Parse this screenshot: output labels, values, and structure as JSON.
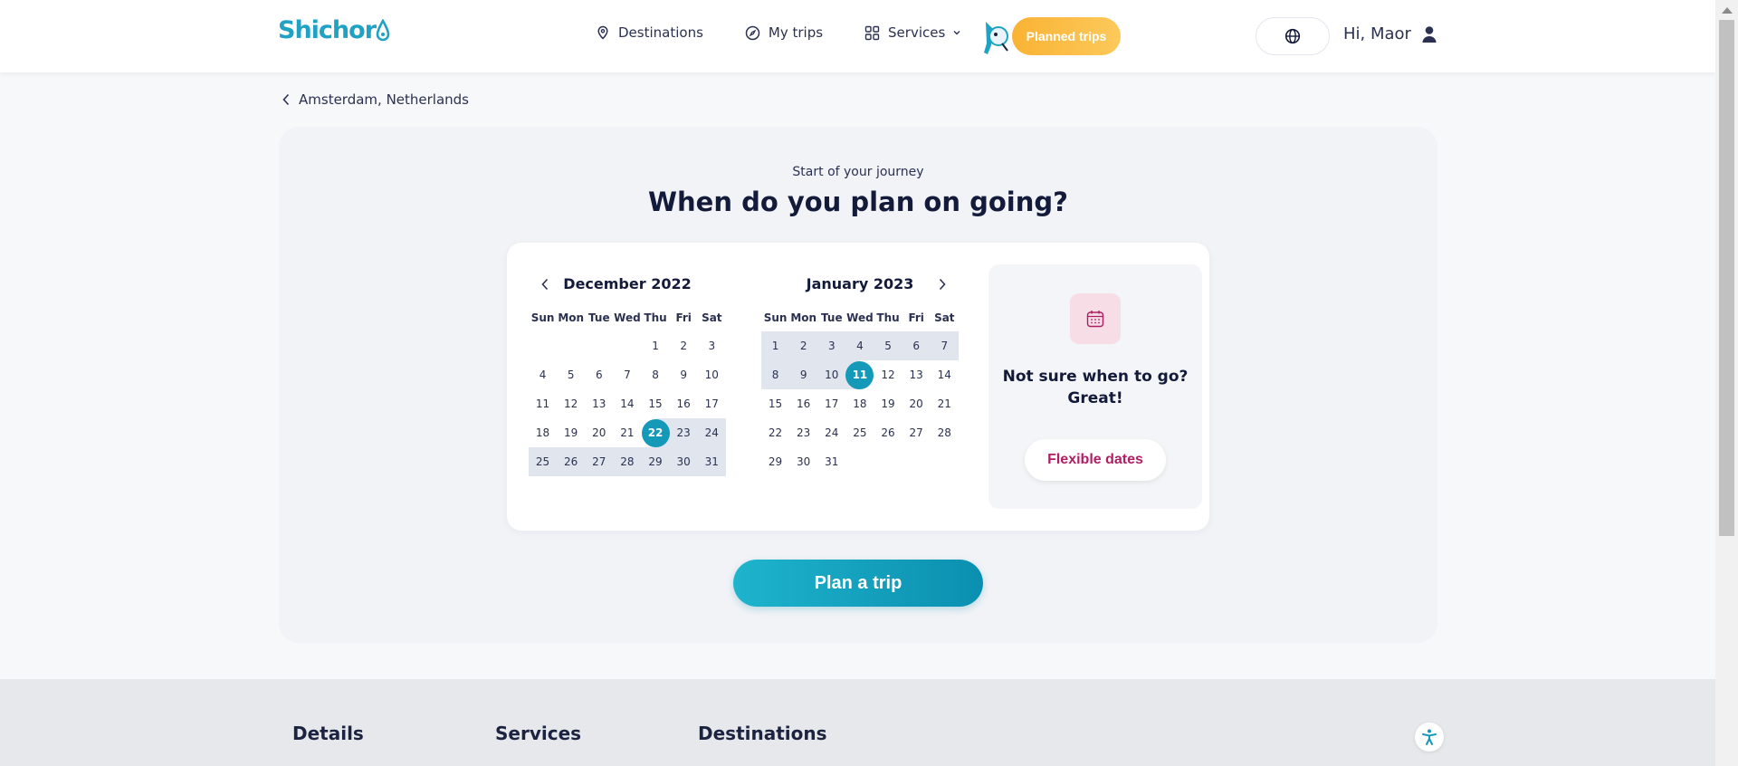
{
  "header": {
    "logo_text": "Shichor",
    "nav": [
      {
        "label": "Destinations",
        "icon": "location-pin-icon"
      },
      {
        "label": "My trips",
        "icon": "compass-icon"
      },
      {
        "label": "Services",
        "icon": "grid-icon"
      }
    ],
    "planned_trips_label": "Planned trips",
    "greeting": "Hi, Maor"
  },
  "breadcrumb": {
    "label": "Amsterdam, Netherlands"
  },
  "main": {
    "subtitle": "Start of your journey",
    "title": "When do you plan on going?"
  },
  "calendar": {
    "weekdays": [
      "Sun",
      "Mon",
      "Tue",
      "Wed",
      "Thu",
      "Fri",
      "Sat"
    ],
    "months": [
      {
        "title": "December 2022",
        "first_weekday": 4,
        "days": 31,
        "selected_start": 22,
        "range_from": 22,
        "range_to": 31
      },
      {
        "title": "January 2023",
        "first_weekday": 0,
        "days": 31,
        "selected_end": 11,
        "range_from": 1,
        "range_to": 11
      }
    ]
  },
  "flexible": {
    "question_line1": "Not sure when to go?",
    "question_line2": "Great!",
    "button_label": "Flexible dates",
    "icon": "calendar-icon"
  },
  "plan_button_label": "Plan a trip",
  "footer": {
    "headings": [
      "Details",
      "Services",
      "Destinations"
    ]
  },
  "colors": {
    "brand": "#1fa2c4",
    "accent_orange": "#f9b334",
    "selected": "#1499b8",
    "flexible_text": "#b01e63"
  }
}
